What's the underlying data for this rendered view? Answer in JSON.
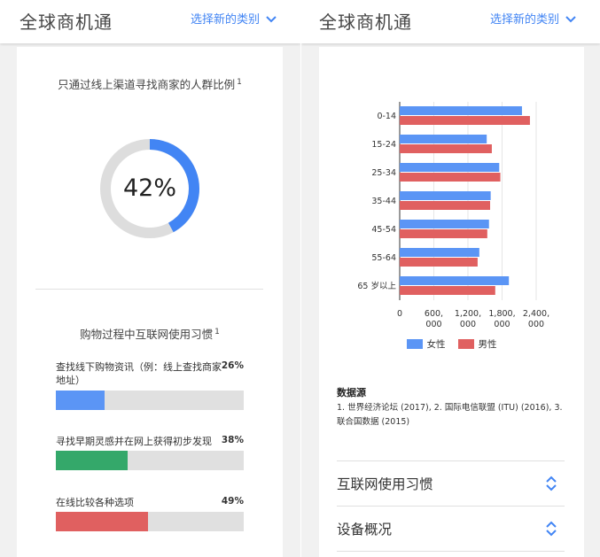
{
  "header": {
    "title": "全球商机通",
    "category_button": "选择新的类别"
  },
  "colors": {
    "accent_blue": "#4285f4",
    "green": "#34a853",
    "red": "#ea4335",
    "male_red": "#e06060"
  },
  "left": {
    "online_share": {
      "title": "只通过线上渠道寻找商家的人群比例",
      "footnote": "1",
      "value": 42,
      "label": "42%"
    },
    "habits": {
      "title": "购物过程中互联网使用习惯",
      "footnote": "1",
      "items": [
        {
          "label": "查找线下购物资讯（例：线上查找商家地址）",
          "value_text": "26%",
          "value": 26,
          "color": "#5b95f5"
        },
        {
          "label": "寻找早期灵感并在网上获得初步发现",
          "value_text": "38%",
          "value": 38,
          "color": "#34a86a"
        },
        {
          "label": "在线比较各种选项",
          "value_text": "49%",
          "value": 49,
          "color": "#e06060"
        }
      ]
    }
  },
  "right": {
    "header": {
      "title": "全球商机通",
      "category_button": "选择新的类别"
    },
    "legend": {
      "female": "女性",
      "male": "男性"
    },
    "source": {
      "title": "数据源",
      "body": "1. 世界经济论坛 (2017), 2. 国际电信联盟 (ITU) (2016), 3. 联合国数据 (2015)"
    },
    "accordion": [
      {
        "label": "互联网使用习惯"
      },
      {
        "label": "设备概况"
      }
    ]
  },
  "chart_data": {
    "type": "bar",
    "orientation": "horizontal",
    "categories": [
      "0-14",
      "15-24",
      "25-34",
      "35-44",
      "45-54",
      "55-64",
      "65 岁以上"
    ],
    "series": [
      {
        "name": "女性",
        "color": "#5b95f5",
        "values": [
          2150,
          1530,
          1750,
          1600,
          1570,
          1400,
          1920
        ]
      },
      {
        "name": "男性",
        "color": "#e06060",
        "values": [
          2290,
          1620,
          1770,
          1590,
          1540,
          1370,
          1680
        ]
      }
    ],
    "x_ticks": [
      "0",
      "600,\n000",
      "1,200,\n000",
      "1,800,\n000",
      "2,400,\n000"
    ],
    "xlim": [
      0,
      2400
    ],
    "legend_position": "bottom",
    "grid": true
  }
}
